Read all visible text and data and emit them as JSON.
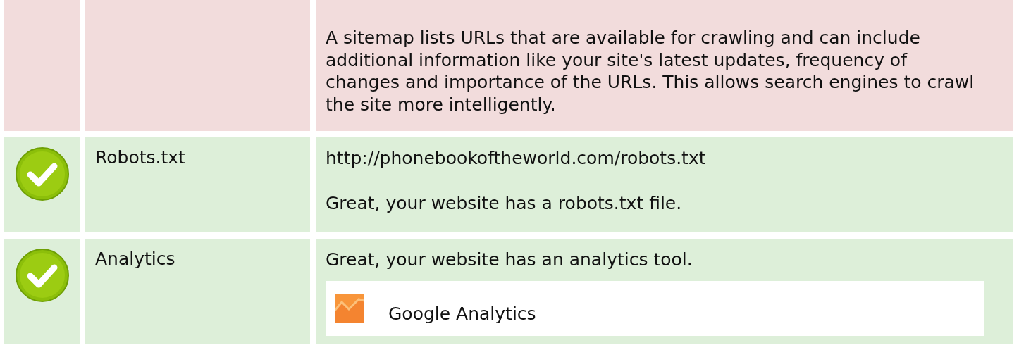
{
  "rows": [
    {
      "kind": "info",
      "label": "",
      "paragraphs": [
        "A sitemap lists URLs that are available for crawling and can include additional information like your site's latest updates, frequency of changes and importance of the URLs. This allows search engines to crawl the site more intelligently."
      ],
      "tools": []
    },
    {
      "kind": "pass",
      "label": "Robots.txt",
      "paragraphs": [
        "http://phonebookoftheworld.com/robots.txt",
        "Great, your website has a robots.txt file."
      ],
      "tools": []
    },
    {
      "kind": "pass",
      "label": "Analytics",
      "paragraphs": [
        "Great, your website has an analytics tool."
      ],
      "tools": [
        {
          "name": "Google Analytics"
        }
      ]
    }
  ]
}
